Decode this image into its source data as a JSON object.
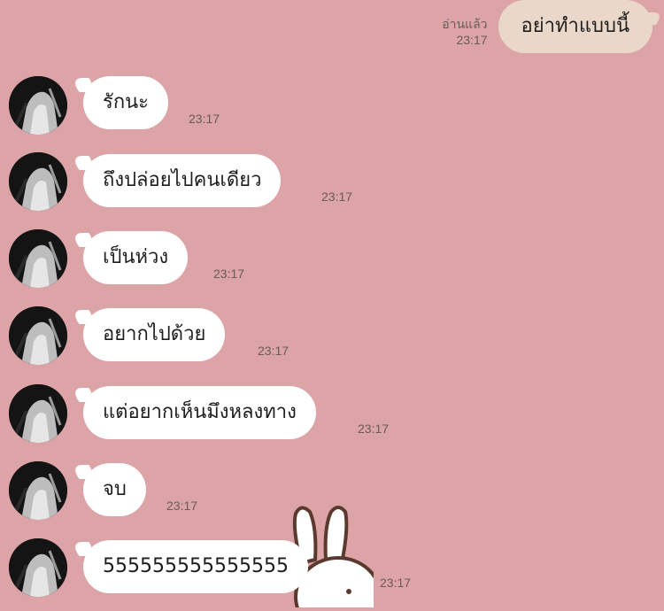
{
  "outgoing": {
    "read_label": "อ่านแล้ว",
    "time": "23:17",
    "text": "อย่าทำแบบนี้"
  },
  "incoming": [
    {
      "text": "รักนะ",
      "time": "23:17"
    },
    {
      "text": "ถึงปล่อยไปคนเดียว",
      "time": "23:17"
    },
    {
      "text": "เป็นห่วง",
      "time": "23:17"
    },
    {
      "text": "อยากไปด้วย",
      "time": "23:17"
    },
    {
      "text": "แต่อยากเห็นมึงหลงทาง",
      "time": "23:17"
    },
    {
      "text": "จบ",
      "time": "23:17"
    },
    {
      "text": "555555555555555",
      "time": "23:17"
    }
  ],
  "colors": {
    "background": "#dca4a6",
    "outgoing_bubble": "#e9d8ca",
    "incoming_bubble": "#ffffff",
    "meta_text": "#6b5a58"
  },
  "icons": {
    "avatar": "avatar-photo",
    "sticker": "bunny-sticker"
  }
}
